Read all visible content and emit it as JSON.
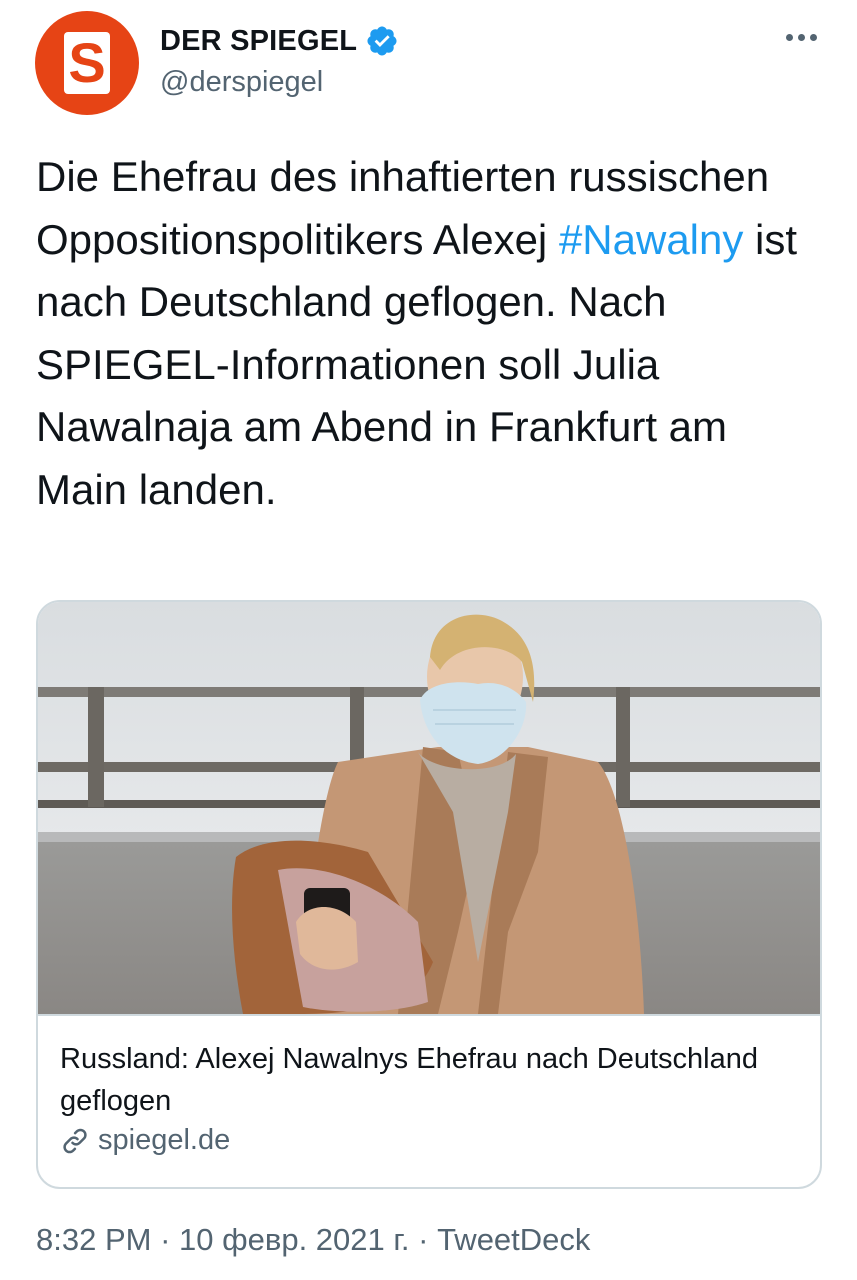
{
  "author": {
    "display_name": "DER SPIEGEL",
    "handle": "@derspiegel",
    "avatar_letter": "S",
    "avatar_color": "#e64415"
  },
  "icons": {
    "verified": "verified-badge-icon",
    "more": "more-options-icon",
    "link": "link-icon"
  },
  "tweet": {
    "text_part1": "Die Ehefrau des inhaftierten russischen Oppositionspolitikers Alexej ",
    "hashtag": "#Nawalny",
    "text_part2": " ist nach Deutschland geflogen. Nach SPIEGEL-Informationen soll Julia Nawalnaja am Abend in Frankfurt am Main landen."
  },
  "card": {
    "title": "Russland: Alexej Nawalnys Ehefrau nach Deutschland geflogen",
    "domain": "spiegel.de"
  },
  "meta": {
    "time": "8:32 PM",
    "separator": " · ",
    "date": "10 февр. 2021 г.",
    "source": "TweetDeck"
  },
  "colors": {
    "accent": "#1d9bf0",
    "secondary_text": "#536471",
    "border": "#cfd9de"
  }
}
